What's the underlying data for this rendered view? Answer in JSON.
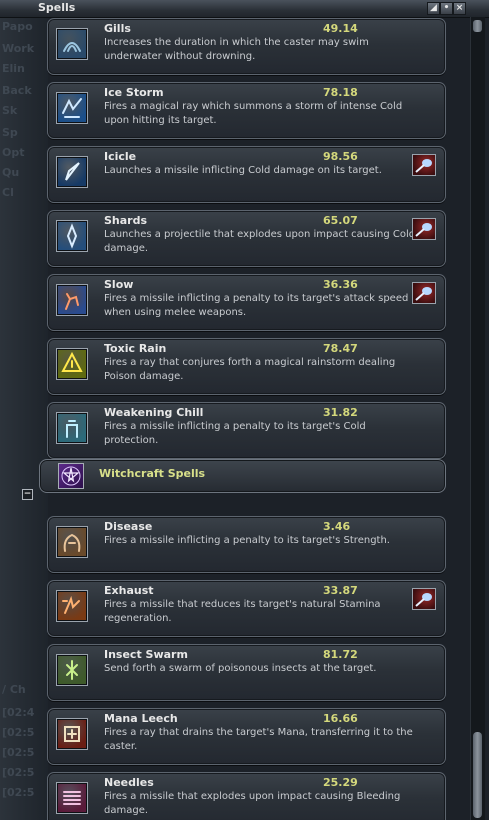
{
  "window": {
    "title": "Spells"
  },
  "background_ghost_text": [
    "Papo",
    "Work",
    "Elin",
    "Back",
    "Sk",
    "Sp",
    "Opt",
    "Qu",
    "Cl",
    "/ Ch",
    "[02:4",
    "[02:5",
    "[02:5",
    "[02:5",
    "[02:5"
  ],
  "spells_top": [
    {
      "name": "Gills",
      "value": "49.14",
      "desc": "Increases the duration in which the caster may swim underwater without drowning.",
      "icon": "gills-icon",
      "missile": false
    },
    {
      "name": "Ice Storm",
      "value": "78.18",
      "desc": "Fires a magical ray which summons a storm of intense Cold upon hitting its target.",
      "icon": "ice-storm-icon",
      "missile": false
    },
    {
      "name": "Icicle",
      "value": "98.56",
      "desc": "Launches a missile inflicting Cold damage on its target.",
      "icon": "icicle-icon",
      "missile": true
    },
    {
      "name": "Shards",
      "value": "65.07",
      "desc": "Launches a projectile that explodes upon impact causing Cold damage.",
      "icon": "shards-icon",
      "missile": true
    },
    {
      "name": "Slow",
      "value": "36.36",
      "desc": "Fires a missile inflicting a penalty to its target's attack speed when using melee weapons.",
      "icon": "slow-icon",
      "missile": true
    },
    {
      "name": "Toxic Rain",
      "value": "78.47",
      "desc": "Fires a ray that conjures forth a magical rainstorm dealing Poison damage.",
      "icon": "toxic-rain-icon",
      "missile": false
    },
    {
      "name": "Weakening Chill",
      "value": "31.82",
      "desc": "Fires a missile inflicting a penalty to its target's Cold protection.",
      "icon": "weakening-chill-icon",
      "missile": false
    }
  ],
  "category": {
    "title": "Witchcraft Spells",
    "collapse_symbol": "−"
  },
  "spells_witchcraft": [
    {
      "name": "Disease",
      "value": "3.46",
      "desc": "Fires a missile inflicting a penalty to its target's Strength.",
      "icon": "disease-icon",
      "missile": false
    },
    {
      "name": "Exhaust",
      "value": "33.87",
      "desc": "Fires a missile that reduces its target's natural Stamina regeneration.",
      "icon": "exhaust-icon",
      "missile": true
    },
    {
      "name": "Insect Swarm",
      "value": "81.72",
      "desc": "Send forth a swarm of poisonous insects at the target.",
      "icon": "insect-swarm-icon",
      "missile": false
    },
    {
      "name": "Mana Leech",
      "value": "16.66",
      "desc": "Fires a ray that drains the target's Mana, transferring it to the caster.",
      "icon": "mana-leech-icon",
      "missile": false
    },
    {
      "name": "Needles",
      "value": "25.29",
      "desc": "Fires a missile that explodes upon impact causing Bleeding damage.",
      "icon": "needles-icon",
      "missile": false
    }
  ],
  "colors": {
    "value": "#d4d87c",
    "name": "#e8e8e8",
    "desc": "#c9ccd0",
    "category_title": "#d8e08a"
  }
}
